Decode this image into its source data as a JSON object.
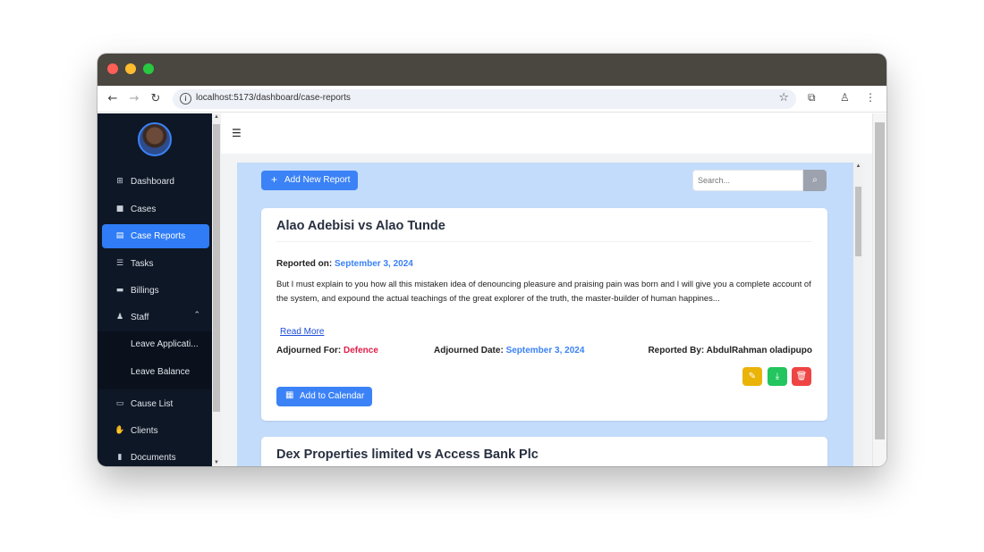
{
  "browser": {
    "url": "localhost:5173/dashboard/case-reports",
    "info_icon": "info-icon",
    "bookmark_icon": "star-icon"
  },
  "sidebar": {
    "items": [
      {
        "label": "Dashboard",
        "icon": "grid-icon",
        "glyph": "⊞"
      },
      {
        "label": "Cases",
        "icon": "briefcase-icon",
        "glyph": "■"
      },
      {
        "label": "Case Reports",
        "icon": "report-icon",
        "glyph": "▤"
      },
      {
        "label": "Tasks",
        "icon": "list-check-icon",
        "glyph": "☰"
      },
      {
        "label": "Billings",
        "icon": "money-icon",
        "glyph": "▬"
      },
      {
        "label": "Staff",
        "icon": "users-icon",
        "glyph": "♟"
      },
      {
        "label": "Cause List",
        "icon": "calendar-list-icon",
        "glyph": "▭"
      },
      {
        "label": "Clients",
        "icon": "handshake-icon",
        "glyph": "✋"
      },
      {
        "label": "Documents",
        "icon": "document-icon",
        "glyph": "▮"
      }
    ],
    "staff_submenu": [
      "Leave Applicati...",
      "Leave Balance"
    ]
  },
  "toolbar": {
    "add_report_label": "Add New Report",
    "search_placeholder": "Search..."
  },
  "reports": [
    {
      "title": "Alao Adebisi vs Alao Tunde",
      "reported_on_label": "Reported on:",
      "reported_on": "September 3, 2024",
      "description": "But I must explain to you how all this mistaken idea of denouncing pleasure and praising pain was born and I will give you a complete account of the system, and expound the actual teachings of the great explorer of the truth, the master-builder of human happines...",
      "read_more": "Read More",
      "adjourned_for_label": "Adjourned For:",
      "adjourned_for": "Defence",
      "adjourned_date_label": "Adjourned Date:",
      "adjourned_date": "September 3, 2024",
      "reported_by_label": "Reported By:",
      "reported_by": "AbdulRahman oladipupo",
      "calendar_label": "Add to Calendar"
    },
    {
      "title": "Dex Properties limited vs Access Bank Plc"
    }
  ],
  "colors": {
    "primary": "#3b82f6",
    "sidebar_bg": "#0e1726",
    "content_bg": "#c3dcfb",
    "edit": "#eab308",
    "download": "#22c55e",
    "delete": "#ef4444",
    "adjourned_for": "#e11d48"
  }
}
